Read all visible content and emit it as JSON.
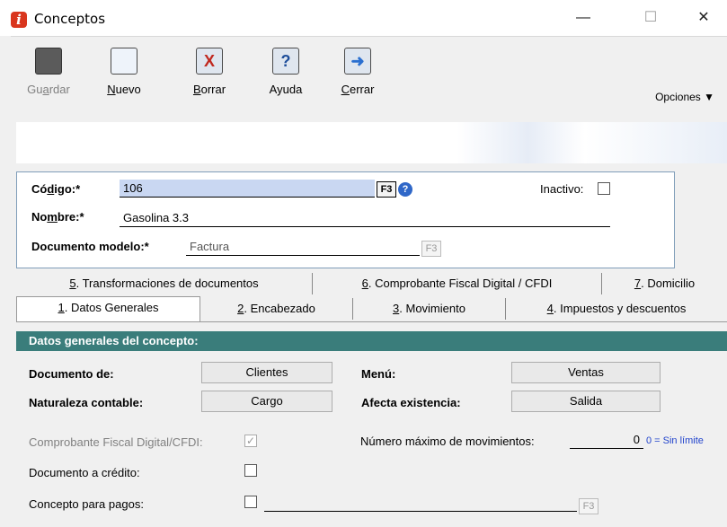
{
  "window": {
    "title": "Conceptos",
    "app_icon_letter": "i",
    "minimize": "—",
    "maximize": "☐",
    "close": "✕"
  },
  "toolbar": {
    "guardar": {
      "pre": "Gu",
      "ul": "a",
      "post": "rdar"
    },
    "nuevo": {
      "pre": "",
      "ul": "N",
      "post": "uevo"
    },
    "borrar": {
      "pre": "",
      "ul": "B",
      "post": "orrar"
    },
    "ayuda": {
      "pre": "Ayuda",
      "ul": "",
      "post": ""
    },
    "cerrar": {
      "pre": "",
      "ul": "C",
      "post": "errar"
    },
    "opciones": "Opciones ▼"
  },
  "header": {
    "codigo": {
      "pre": "Có",
      "ul": "d",
      "post": "igo:*",
      "value": "106",
      "f3": "F3"
    },
    "nombre": {
      "pre": "No",
      "ul": "m",
      "post": "bre:*",
      "value": "Gasolina 3.3"
    },
    "documento_modelo": {
      "label": "Documento modelo:*",
      "value": "Factura",
      "f3": "F3"
    },
    "inactivo_label": "Inactivo:",
    "inactivo_checked": false
  },
  "tabs_row1": [
    {
      "ul": "5",
      "post": ". Transformaciones de documentos"
    },
    {
      "ul": "6",
      "post": ". Comprobante Fiscal Digital / CFDI"
    },
    {
      "ul": "7",
      "post": ". Domicilio"
    }
  ],
  "tabs_row2": [
    {
      "ul": "1",
      "post": ". Datos Generales"
    },
    {
      "ul": "2",
      "post": ". Encabezado"
    },
    {
      "ul": "3",
      "post": ". Movimiento"
    },
    {
      "ul": "4",
      "post": ". Impuestos y descuentos"
    }
  ],
  "general": {
    "section_title": "Datos generales del concepto:",
    "documento_de_label": "Documento de:",
    "documento_de_value": "Clientes",
    "menu_label": "Menú:",
    "menu_value": "Ventas",
    "naturaleza_label": "Naturaleza contable:",
    "naturaleza_value": "Cargo",
    "afecta_label": "Afecta existencia:",
    "afecta_value": "Salida",
    "cfdi_label": "Comprobante Fiscal Digital/CFDI:",
    "cfdi_checked": true,
    "max_mov_label": "Número máximo de movimientos:",
    "max_mov_value": "0",
    "max_mov_hint": "0 = Sin límite",
    "credito_label": "Documento a crédito:",
    "credito_checked": false,
    "pagos_label": "Concepto para pagos:",
    "pagos_checked": false,
    "pagos_f3": "F3"
  },
  "colors": {
    "section_head": "#3a7d7b",
    "app_icon": "#d9361e",
    "help_icon": "#2f67c8"
  }
}
